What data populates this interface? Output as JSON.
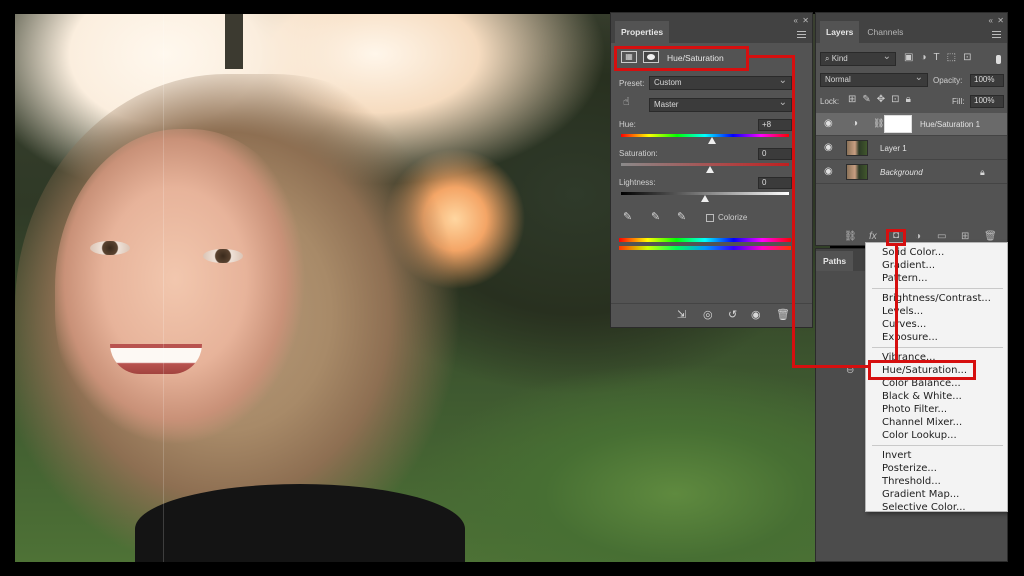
{
  "properties_panel": {
    "tab": "Properties",
    "adjustment_title": "Hue/Saturation",
    "preset_label": "Preset:",
    "preset_value": "Custom",
    "channel_value": "Master",
    "hue_label": "Hue:",
    "hue_value": "+8",
    "saturation_label": "Saturation:",
    "saturation_value": "0",
    "lightness_label": "Lightness:",
    "lightness_value": "0",
    "colorize_label": "Colorize"
  },
  "layers_panel": {
    "tabs": [
      "Layers",
      "Channels"
    ],
    "kind_label": "Kind",
    "blend_mode": "Normal",
    "opacity_label": "Opacity:",
    "opacity_value": "100%",
    "lock_label": "Lock:",
    "fill_label": "Fill:",
    "fill_value": "100%",
    "layers": [
      {
        "name": "Hue/Saturation 1"
      },
      {
        "name": "Layer 1"
      },
      {
        "name": "Background"
      }
    ],
    "paths_tab": "Paths",
    "fx_label": "fx"
  },
  "adjustment_menu": {
    "group1": [
      "Solid Color...",
      "Gradient...",
      "Pattern..."
    ],
    "group2": [
      "Brightness/Contrast...",
      "Levels...",
      "Curves...",
      "Exposure..."
    ],
    "group3": [
      "Vibrance...",
      "Hue/Saturation...",
      "Color Balance...",
      "Black & White...",
      "Photo Filter...",
      "Channel Mixer...",
      "Color Lookup..."
    ],
    "group4": [
      "Invert",
      "Posterize...",
      "Threshold...",
      "Gradient Map...",
      "Selective Color..."
    ]
  },
  "colors": {
    "panel_bg": "#535353",
    "annotation_red": "#d60f0f",
    "menu_bg": "#f3f3f3"
  },
  "icons": [
    "eye-icon",
    "lock-icon",
    "hand-tool-icon",
    "eyedropper-icon",
    "chain-link-icon",
    "fx-icon",
    "adjustment-layer-icon",
    "folder-icon",
    "new-layer-icon",
    "trash-icon",
    "mask-icon",
    "reset-icon",
    "visibility-icon",
    "clip-icon",
    "search-icon"
  ]
}
